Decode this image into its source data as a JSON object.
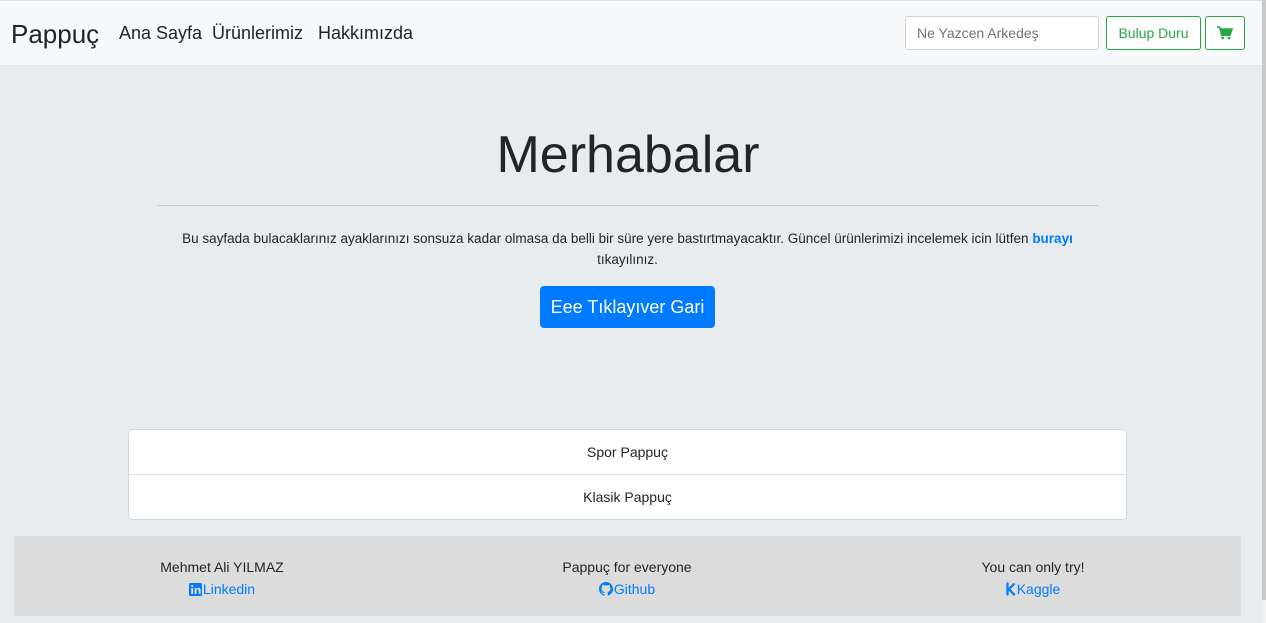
{
  "navbar": {
    "brand": "Pappuç",
    "links": [
      "Ana Sayfa",
      "Ürünlerimiz",
      "Hakkımızda"
    ],
    "search_placeholder": "Ne Yazcen Arkedeş",
    "search_button": "Bulup Duru",
    "cart_icon": "cart-icon"
  },
  "hero": {
    "title": "Merhabalar",
    "text_before": "Bu sayfada bulacaklarınız ayaklarınızı sonsuza kadar olmasa da belli bir süre yere bastırtmayacaktır. Güncel ürünlerimizi incelemek icin lütfen ",
    "link_text": "burayı",
    "text_after": " tıkayılınız.",
    "button": "Eee Tıklayıver Gari"
  },
  "categories": [
    "Spor Pappuç",
    "Klasik Pappuç"
  ],
  "footer": {
    "columns": [
      {
        "text": "Mehmet Ali YILMAZ",
        "link": "Linkedin",
        "icon": "linkedin-icon"
      },
      {
        "text": "Pappuç for everyone",
        "link": "Github",
        "icon": "github-icon"
      },
      {
        "text": "You can only try!",
        "link": "Kaggle",
        "icon": "kaggle-icon"
      }
    ]
  },
  "colors": {
    "primary": "#007bff",
    "success": "#28a745",
    "background": "#e9ecef",
    "navbar": "#f8f9fa",
    "footer": "#dcdcdc"
  }
}
